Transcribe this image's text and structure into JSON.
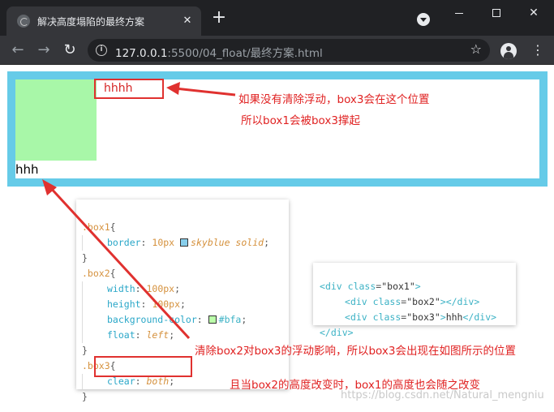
{
  "browser": {
    "tab_title": "解决高度塌陷的最终方案",
    "tab_close": "✕",
    "new_tab": "+",
    "url_host": "127.0.0.1",
    "url_path": ":5500/04_float/最终方案.html",
    "icons": [
      "globe-icon",
      "close-icon",
      "plus-icon",
      "tab-search-icon",
      "minimize-icon",
      "maximize-icon",
      "close-window-icon",
      "back-icon",
      "forward-icon",
      "reload-icon",
      "info-icon",
      "star-icon",
      "profile-icon",
      "menu-icon"
    ]
  },
  "page": {
    "box3_text": "hhh",
    "float_ghost_text": "hhhh",
    "notes": {
      "n1": "如果没有清除浮动，box3会在这个位置",
      "n2": "所以box1会被box3撑起",
      "n3": "清除box2对box3的浮动影响，所以box3会出现在如图所示的位置",
      "n4": "且当box2的高度改变时，box1的高度也会随之改变"
    },
    "watermark": "https://blog.csdn.net/Natural_mengniu",
    "colors": {
      "box1_border": "#66cbe8",
      "box2_bg": "#a8f7a8",
      "annotation_red": "#e0312f"
    }
  },
  "css_code": {
    "box1_sel": ".box1",
    "box1_prop": "border",
    "box1_num": "10px",
    "box1_val": "skyblue solid",
    "box2_sel": ".box2",
    "w_prop": "width",
    "w_val": "100px",
    "h_prop": "height",
    "h_val": "100px",
    "bg_prop": "background-color",
    "bg_val": "#bfa",
    "f_prop": "float",
    "f_val": "left",
    "box3_sel": ".box3",
    "c_prop": "clear",
    "c_val": "both"
  },
  "html_code": {
    "l1_tag": "div",
    "l1_attr": "class",
    "l1_val": "\"box1\"",
    "l2_tag": "div",
    "l2_attr": "class",
    "l2_val": "\"box2\"",
    "l2_close": "div",
    "l3_tag": "div",
    "l3_attr": "class",
    "l3_val": "\"box3\"",
    "l3_text": "hhh",
    "l3_close": "div",
    "l4_close": "div"
  }
}
